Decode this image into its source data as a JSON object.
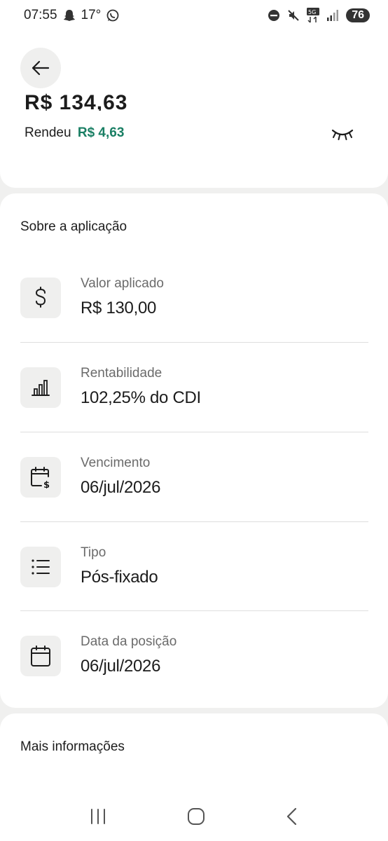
{
  "status_bar": {
    "time": "07:55",
    "temperature": "17°",
    "battery": "76",
    "network": "5G",
    "icons": [
      "snapchat-icon",
      "whatsapp-icon",
      "dnd-icon",
      "mute-icon",
      "network-icon",
      "signal-icon",
      "battery-icon"
    ]
  },
  "header": {
    "partial_value": "R$ 134,63",
    "rendeu_label": "Rendeu",
    "rendeu_amount": "R$ 4,63"
  },
  "about": {
    "title": "Sobre a aplicação",
    "rows": [
      {
        "label": "Valor aplicado",
        "value": "R$ 130,00",
        "icon": "dollar-icon"
      },
      {
        "label": "Rentabilidade",
        "value": "102,25% do CDI",
        "icon": "bar-chart-icon"
      },
      {
        "label": "Vencimento",
        "value": "06/jul/2026",
        "icon": "calendar-dollar-icon"
      },
      {
        "label": "Tipo",
        "value": "Pós-fixado",
        "icon": "list-icon"
      },
      {
        "label": "Data da posição",
        "value": "06/jul/2026",
        "icon": "calendar-icon"
      }
    ]
  },
  "more": {
    "title": "Mais informações"
  },
  "colors": {
    "accent_green": "#1a7f64",
    "background": "#f0f0ef",
    "card": "#ffffff"
  }
}
